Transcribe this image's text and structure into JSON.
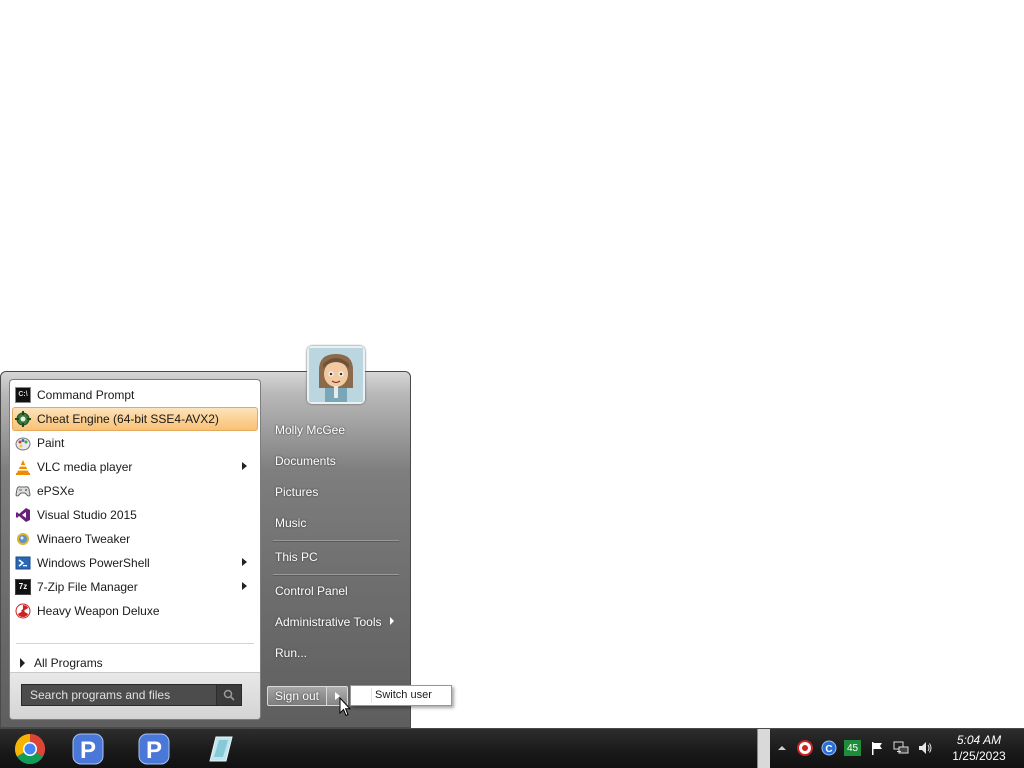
{
  "start_menu": {
    "programs": [
      {
        "label": "Command Prompt",
        "icon": "command-prompt-icon",
        "highlighted": false,
        "has_submenu": false
      },
      {
        "label": "Cheat Engine (64-bit SSE4-AVX2)",
        "icon": "cheat-engine-icon",
        "highlighted": true,
        "has_submenu": false
      },
      {
        "label": "Paint",
        "icon": "paint-icon",
        "highlighted": false,
        "has_submenu": false
      },
      {
        "label": "VLC media player",
        "icon": "vlc-icon",
        "highlighted": false,
        "has_submenu": true
      },
      {
        "label": "ePSXe",
        "icon": "gamepad-icon",
        "highlighted": false,
        "has_submenu": false
      },
      {
        "label": "Visual Studio 2015",
        "icon": "visual-studio-icon",
        "highlighted": false,
        "has_submenu": false
      },
      {
        "label": "Winaero Tweaker",
        "icon": "winaero-icon",
        "highlighted": false,
        "has_submenu": false
      },
      {
        "label": "Windows PowerShell",
        "icon": "powershell-icon",
        "highlighted": false,
        "has_submenu": true
      },
      {
        "label": "7-Zip File Manager",
        "icon": "7zip-icon",
        "highlighted": false,
        "has_submenu": true
      },
      {
        "label": "Heavy Weapon Deluxe",
        "icon": "radiation-icon",
        "highlighted": false,
        "has_submenu": false
      }
    ],
    "all_programs": "All Programs",
    "search": {
      "placeholder": "Search programs and files",
      "value": ""
    },
    "user": {
      "name": "Molly McGee"
    },
    "places": {
      "documents": "Documents",
      "pictures": "Pictures",
      "music": "Music",
      "this_pc": "This PC",
      "control_panel": "Control Panel",
      "admin_tools": "Administrative Tools",
      "run": "Run..."
    },
    "sign_out": "Sign out",
    "flyout": {
      "switch_user": "Switch user"
    }
  },
  "taskbar": {
    "pinned": [
      "chrome-icon",
      "p-app-icon",
      "p-app-icon",
      "paper-icon"
    ],
    "tray_badge": "45",
    "clock": {
      "time": "5:04 AM",
      "date": "1/25/2023"
    }
  },
  "colors": {
    "highlight": "#fbd195",
    "taskbar": "#191919",
    "right_pane": "#6e6e6e"
  }
}
